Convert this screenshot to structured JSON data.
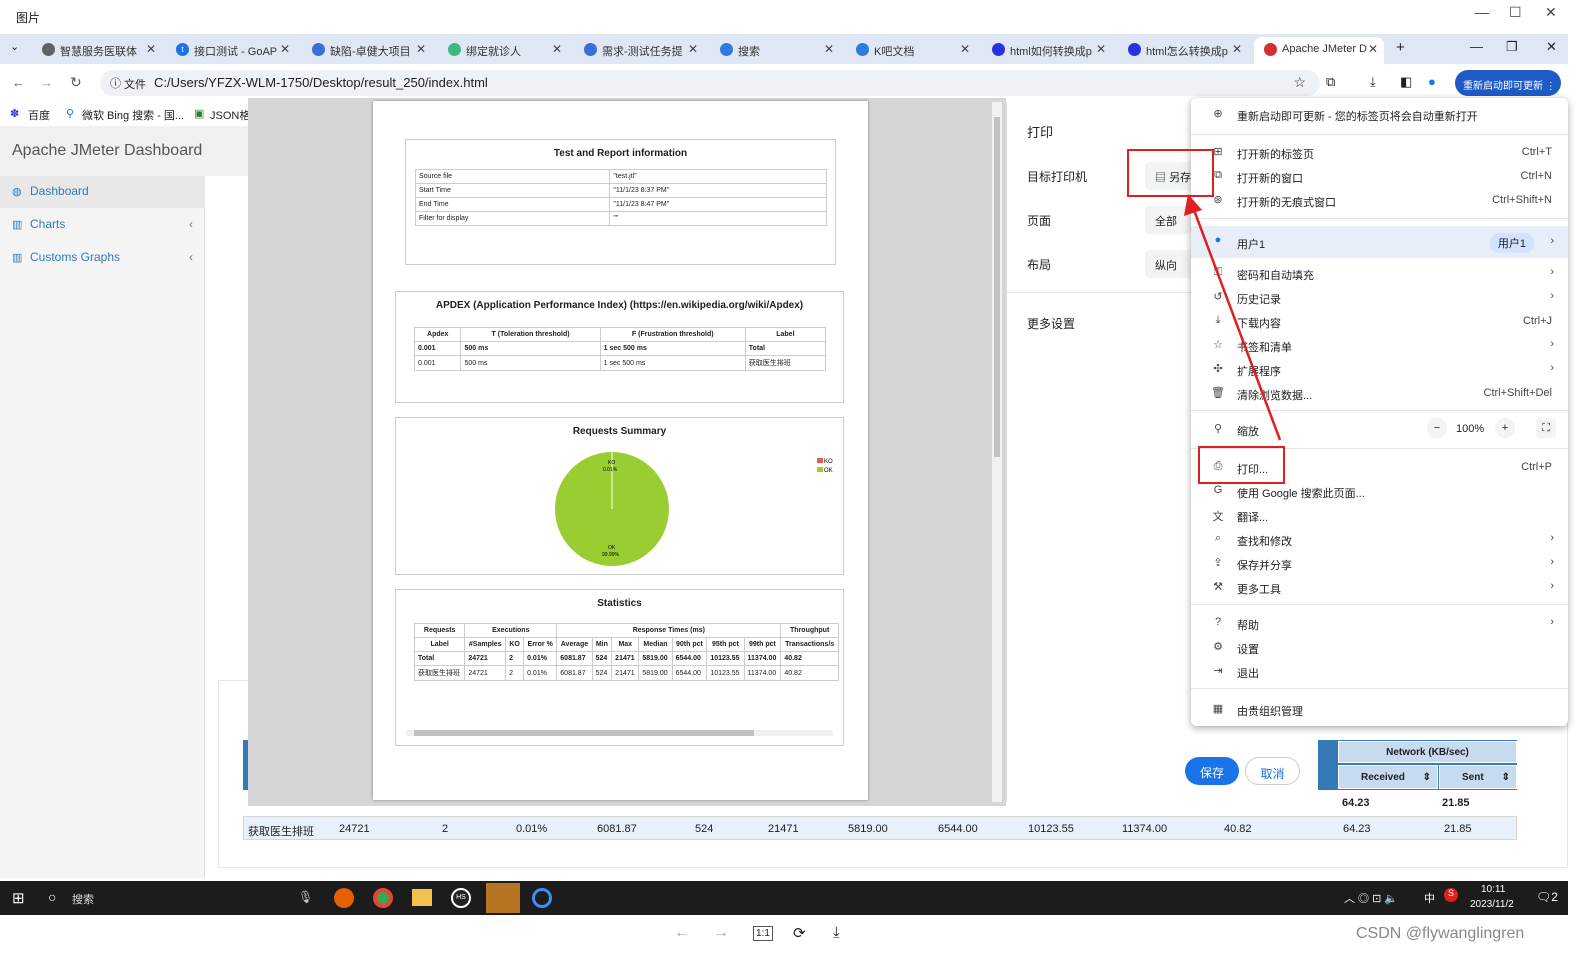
{
  "viewer": {
    "title": "图片",
    "min": "—",
    "max": "☐",
    "close": "✕"
  },
  "tabs": [
    {
      "icon": "globe-icon",
      "label": "智慧服务医联体"
    },
    {
      "icon": "t-icon",
      "label": "接口测试 - GoAP"
    },
    {
      "icon": "project-icon",
      "label": "缺陷-卓健大项目"
    },
    {
      "icon": "vue-icon",
      "label": "绑定就诊人"
    },
    {
      "icon": "project-icon",
      "label": "需求-测试任务提"
    },
    {
      "icon": "search-icon",
      "label": "搜索"
    },
    {
      "icon": "k-icon",
      "label": "K吧文档"
    },
    {
      "icon": "baidu-icon",
      "label": "html如何转换成p"
    },
    {
      "icon": "baidu-icon",
      "label": "html怎么转换成p"
    },
    {
      "icon": "jmeter-icon",
      "label": "Apache JMeter D"
    }
  ],
  "address": {
    "scheme_label": "文件",
    "url": "C:/Users/YFZX-WLM-1750/Desktop/result_250/index.html",
    "update_label": "重新启动即可更新"
  },
  "bookmarks": [
    "百度",
    "微软 Bing 搜索 - 国...",
    "JSON格式"
  ],
  "dashboard": {
    "brand": "Apache JMeter Dashboard",
    "nav": [
      {
        "label": "Dashboard"
      },
      {
        "label": "Charts"
      },
      {
        "label": "Customs Graphs"
      }
    ]
  },
  "report": {
    "info_title": "Test and Report information",
    "info_rows": [
      [
        "Source file",
        "\"test.jtl\""
      ],
      [
        "Start Time",
        "\"11/1/23 8:37 PM\""
      ],
      [
        "End Time",
        "\"11/1/23 8:47 PM\""
      ],
      [
        "Filter for display",
        "\"\""
      ]
    ],
    "apdex_title": "APDEX (Application Performance Index) (https://en.wikipedia.org/wiki/Apdex)",
    "apdex_headers": [
      "Apdex",
      "T (Toleration threshold)",
      "F (Frustration threshold)",
      "Label"
    ],
    "apdex_rows": [
      [
        "0.001",
        "500 ms",
        "1 sec 500 ms",
        "Total"
      ],
      [
        "0.001",
        "500 ms",
        "1 sec 500 ms",
        "获取医生排班"
      ]
    ],
    "summary_title": "Requests Summary",
    "pie": {
      "ko_label": "KO",
      "ko_pct": "0.01%",
      "ok_label": "OK",
      "ok_pct": "99.99%",
      "ok_color": "#9acd32",
      "ko_color": "#f15a50"
    },
    "stats_title": "Statistics",
    "stats_group": [
      "Requests",
      "Executions",
      "Response Times (ms)",
      "Throughput"
    ],
    "stats_headers": [
      "Label",
      "#Samples",
      "KO",
      "Error %",
      "Average",
      "Min",
      "Max",
      "Median",
      "90th pct",
      "95th pct",
      "99th pct",
      "Transactions/s"
    ],
    "stats_rows": [
      [
        "Total",
        "24721",
        "2",
        "0.01%",
        "6081.87",
        "524",
        "21471",
        "5819.00",
        "6544.00",
        "10123.55",
        "11374.00",
        "40.82"
      ],
      [
        "获取医生排班",
        "24721",
        "2",
        "0.01%",
        "6081.87",
        "524",
        "21471",
        "5819.00",
        "6544.00",
        "10123.55",
        "11374.00",
        "40.82"
      ]
    ]
  },
  "print": {
    "title": "打印",
    "dest_label": "目标打印机",
    "dest_value": "另存",
    "pages_label": "页面",
    "pages_value": "全部",
    "layout_label": "布局",
    "layout_value": "纵向",
    "more_label": "更多设置",
    "save": "保存",
    "cancel": "取消"
  },
  "bg_table": {
    "network_header": "Network (KB/sec)",
    "received": "Received",
    "sent": "Sent",
    "row1": [
      "64.23",
      "21.85"
    ],
    "row2": [
      "获取医生排班",
      "24721",
      "2",
      "0.01%",
      "6081.87",
      "524",
      "21471",
      "5819.00",
      "6544.00",
      "10123.55",
      "11374.00",
      "40.82",
      "64.23",
      "21.85"
    ]
  },
  "menu": {
    "update": "重新启动即可更新 - 您的标签页将会自动重新打开",
    "items": [
      {
        "label": "打开新的标签页",
        "shortcut": "Ctrl+T"
      },
      {
        "label": "打开新的窗口",
        "shortcut": "Ctrl+N"
      },
      {
        "label": "打开新的无痕式窗口",
        "shortcut": "Ctrl+Shift+N"
      }
    ],
    "user": "用户1",
    "user_badge": "用户1",
    "items2": [
      {
        "label": "密码和自动填充",
        "shortcut": ""
      },
      {
        "label": "历史记录",
        "shortcut": ""
      },
      {
        "label": "下载内容",
        "shortcut": "Ctrl+J"
      },
      {
        "label": "书签和清单",
        "shortcut": ""
      },
      {
        "label": "扩展程序",
        "shortcut": ""
      },
      {
        "label": "清除浏览数据...",
        "shortcut": "Ctrl+Shift+Del"
      }
    ],
    "zoom_label": "缩放",
    "zoom_value": "100%",
    "items3": [
      {
        "label": "打印...",
        "shortcut": "Ctrl+P"
      },
      {
        "label": "使用 Google 搜索此页面...",
        "shortcut": ""
      },
      {
        "label": "翻译...",
        "shortcut": ""
      },
      {
        "label": "查找和修改",
        "shortcut": ""
      },
      {
        "label": "保存并分享",
        "shortcut": ""
      },
      {
        "label": "更多工具",
        "shortcut": ""
      }
    ],
    "items4": [
      {
        "label": "帮助"
      },
      {
        "label": "设置"
      },
      {
        "label": "退出"
      }
    ],
    "managed": "由贵组织管理"
  },
  "taskbar": {
    "search": "搜索",
    "time": "10:11",
    "date": "2023/11/2",
    "ime": "中",
    "notif": "2"
  },
  "watermark": "CSDN @flywanglingren"
}
